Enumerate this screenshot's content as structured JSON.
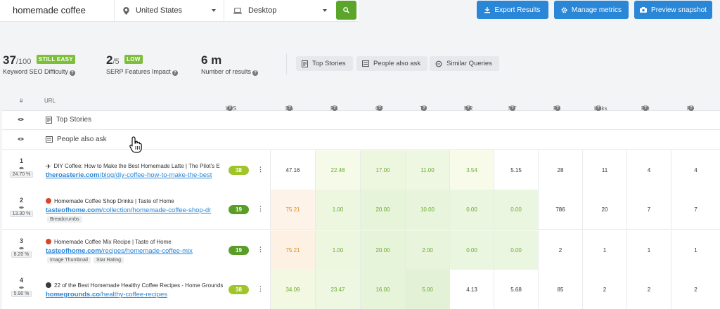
{
  "search": {
    "keyword": "homemade coffee",
    "country": "United States",
    "device": "Desktop"
  },
  "buttons": {
    "export": "Export Results",
    "manage": "Manage metrics",
    "preview": "Preview snapshot"
  },
  "metrics": {
    "difficulty": {
      "value": "37",
      "max": "/100",
      "badge": "STILL EASY",
      "label": "Keyword SEO Difficulty"
    },
    "serp": {
      "value": "2",
      "max": "/5",
      "badge": "LOW",
      "label": "SERP Features Impact"
    },
    "results": {
      "value": "6 m",
      "label": "Number of results"
    }
  },
  "feature_chips": [
    "Top Stories",
    "People also ask",
    "Similar Queries"
  ],
  "columns": [
    "#",
    "URL",
    "LPS",
    "DA",
    "PA",
    "CF",
    "TF",
    "MR",
    "MT",
    "FB",
    "Links",
    "RD",
    "RI"
  ],
  "special_rows": [
    "Top Stories",
    "People also ask"
  ],
  "rows": [
    {
      "rank": "1",
      "pct": "24.70 %",
      "icon": "plane-icon",
      "title": "DIY Coffee: How to Make the Best Homemade Latte | The Pilot's E",
      "domain": "theroasterie.com",
      "path": "/blog/diy-coffee-how-to-make-the-best",
      "tags": [],
      "lps": "38",
      "lps_color": "#9fc52a",
      "DA": "47.16",
      "PA": "22.48",
      "CF": "17.00",
      "TF": "11.00",
      "MR": "3.54",
      "MT": "5.15",
      "FB": "28",
      "Links": "11",
      "RD": "4",
      "RI": "4"
    },
    {
      "rank": "2",
      "pct": "13.30 %",
      "icon": "tomato-icon",
      "title": "Homemade Coffee Shop Drinks | Taste of Home",
      "domain": "tasteofhome.com",
      "path": "/collection/homemade-coffee-shop-dr",
      "tags": [
        "Breadcrumbs"
      ],
      "lps": "19",
      "lps_color": "#5a9e28",
      "DA": "75.21",
      "PA": "1.00",
      "CF": "20.00",
      "TF": "10.00",
      "MR": "0.00",
      "MT": "0.00",
      "FB": "786",
      "Links": "20",
      "RD": "7",
      "RI": "7"
    },
    {
      "rank": "3",
      "pct": "8.20 %",
      "icon": "tomato-icon",
      "title": "Homemade Coffee Mix Recipe | Taste of Home",
      "domain": "tasteofhome.com",
      "path": "/recipes/homemade-coffee-mix",
      "tags": [
        "Image Thumbnail",
        "Star Rating"
      ],
      "lps": "19",
      "lps_color": "#5a9e28",
      "DA": "75.21",
      "PA": "1.00",
      "CF": "20.00",
      "TF": "2.00",
      "MR": "0.00",
      "MT": "0.00",
      "FB": "2",
      "Links": "1",
      "RD": "1",
      "RI": "1"
    },
    {
      "rank": "4",
      "pct": "5.90 %",
      "icon": "coffee-bean-icon",
      "title": "22 of the Best Homemade Healthy Coffee Recipes - Home Grounds",
      "domain": "homegrounds.co",
      "path": "/healthy-coffee-recipes",
      "tags": [],
      "lps": "38",
      "lps_color": "#9fc52a",
      "DA": "34.09",
      "PA": "23.47",
      "CF": "16.00",
      "TF": "5.00",
      "MR": "4.13",
      "MT": "5.68",
      "FB": "85",
      "Links": "2",
      "RD": "2",
      "RI": "2"
    }
  ],
  "cell_colors": {
    "green_text": "#6aaa2e",
    "orange_text": "#e08a2a",
    "gray_text": "#333333"
  }
}
